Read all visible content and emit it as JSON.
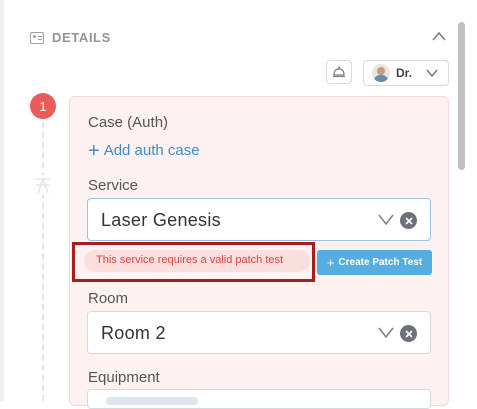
{
  "panel": {
    "section_title": "DETAILS",
    "doctor_label": "Dr.",
    "step_number": "1"
  },
  "form": {
    "case_label": "Case (Auth)",
    "add_auth_label": "Add auth case",
    "service_label": "Service",
    "service_value": "Laser Genesis",
    "warning_text": "This service requires a valid patch test",
    "patch_test_label": "Create Patch Test",
    "room_label": "Room",
    "room_value": "Room 2",
    "equipment_label": "Equipment"
  },
  "icons": {
    "section": "id-card-icon",
    "collapse": "chevron-up-icon",
    "bell": "service-bell-icon",
    "dropdown": "chevron-down-icon",
    "clear": "clear-x-icon",
    "add": "plus-icon"
  },
  "colors": {
    "accent_blue": "#3d8dc6",
    "button_blue": "#56aee0",
    "step_red": "#ea5b5b",
    "warning_red": "#d94343",
    "highlight_border": "#a61e1e",
    "card_bg": "#fdf1f1"
  }
}
